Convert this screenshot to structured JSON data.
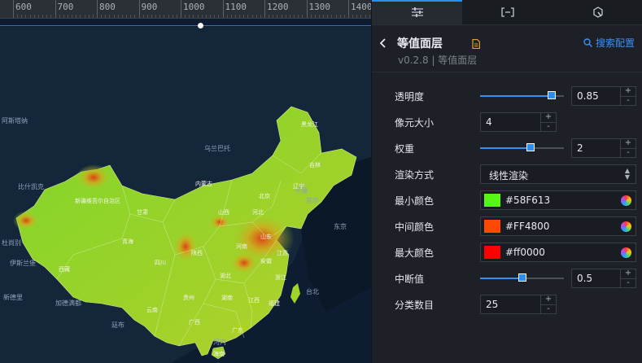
{
  "ruler": {
    "labels": [
      "600",
      "700",
      "800",
      "900",
      "1000",
      "1100",
      "1200",
      "1300",
      "1400"
    ]
  },
  "map": {
    "labels": [
      {
        "text": "阿斯塔纳"
      },
      {
        "text": "比什凯克"
      },
      {
        "text": "乌兰巴托"
      },
      {
        "text": "杜尚别"
      },
      {
        "text": "伊斯兰堡"
      },
      {
        "text": "新德里"
      },
      {
        "text": "加德满都"
      },
      {
        "text": "廷布"
      },
      {
        "text": "河内"
      },
      {
        "text": "首尔"
      },
      {
        "text": "平壤"
      },
      {
        "text": "东京"
      },
      {
        "text": "台北"
      }
    ],
    "provinces": [
      "新疆维吾尔自治区",
      "西藏",
      "青海",
      "四川",
      "甘肃",
      "内蒙古",
      "黑龙江",
      "吉林",
      "辽宁",
      "北京",
      "河北",
      "山西",
      "山东",
      "河南",
      "陕西",
      "湖北",
      "安徽",
      "江苏",
      "浙江",
      "湖南",
      "江西",
      "贵州",
      "云南",
      "广西",
      "广东",
      "福建",
      "海南"
    ],
    "colors": {
      "min": "#58F613",
      "mid": "#FF4800",
      "max": "#ff0000"
    }
  },
  "panel": {
    "tabs": [
      {
        "name": "settings-sliders-icon"
      },
      {
        "name": "bracket-data-icon"
      },
      {
        "name": "interaction-icon"
      }
    ],
    "title": "等值面层",
    "version": "v0.2.8 | 等值面层",
    "search_label": "搜索配置",
    "props": {
      "opacity": {
        "label": "透明度",
        "value": "0.85",
        "fraction": 0.85
      },
      "pixel_size": {
        "label": "像元大小",
        "value": "4"
      },
      "weight": {
        "label": "权重",
        "value": "2",
        "fraction": 0.6
      },
      "render_mode": {
        "label": "渲染方式",
        "value": "线性渲染"
      },
      "min_color": {
        "label": "最小颜色",
        "value": "#58F613",
        "color": "#58F613"
      },
      "mid_color": {
        "label": "中间颜色",
        "value": "#FF4800",
        "color": "#FF4800"
      },
      "max_color": {
        "label": "最大颜色",
        "value": "#ff0000",
        "color": "#ff0000"
      },
      "break_value": {
        "label": "中断值",
        "value": "0.5",
        "fraction": 0.5
      },
      "class_count": {
        "label": "分类数目",
        "value": "25"
      }
    },
    "spin_up": "+",
    "spin_down": "-"
  }
}
